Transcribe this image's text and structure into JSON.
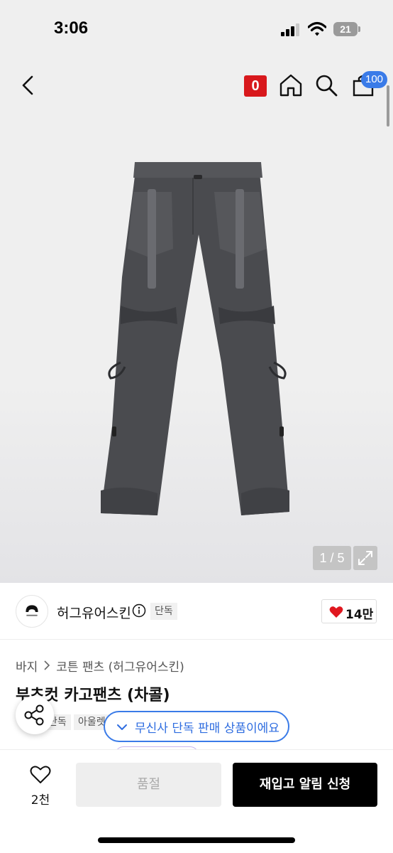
{
  "status_bar": {
    "time": "3:06",
    "battery_level": "21"
  },
  "nav": {
    "brand_logo_text": "0",
    "cart_count": "100"
  },
  "gallery": {
    "counter": "1 / 5"
  },
  "brand": {
    "name": "허그유어스킨",
    "exclusive_badge": "단독",
    "like_count": "14만",
    "heart_color": "#e0171f"
  },
  "breadcrumb": {
    "category": "바지",
    "subcategory": "코튼 팬츠 (허그유어스킨)"
  },
  "product": {
    "title_visible": "부츠컷 카고팬츠 (차콜)",
    "tags": [
      "단독",
      "아울렛"
    ]
  },
  "toast": {
    "text": "무신사 단독 판매 상품이에요",
    "accent_color": "#3a7be8"
  },
  "bottom_bar": {
    "wishlist_count": "2천",
    "soldout_label": "품절",
    "restock_label": "재입고 알림 신청"
  },
  "icons": [
    "signal-icon",
    "wifi-icon",
    "battery-icon",
    "back-arrow-icon",
    "home-icon",
    "search-icon",
    "cart-icon",
    "expand-icon",
    "info-icon",
    "heart-icon",
    "chevron-right-icon",
    "share-icon",
    "check-icon",
    "heart-outline-icon"
  ]
}
